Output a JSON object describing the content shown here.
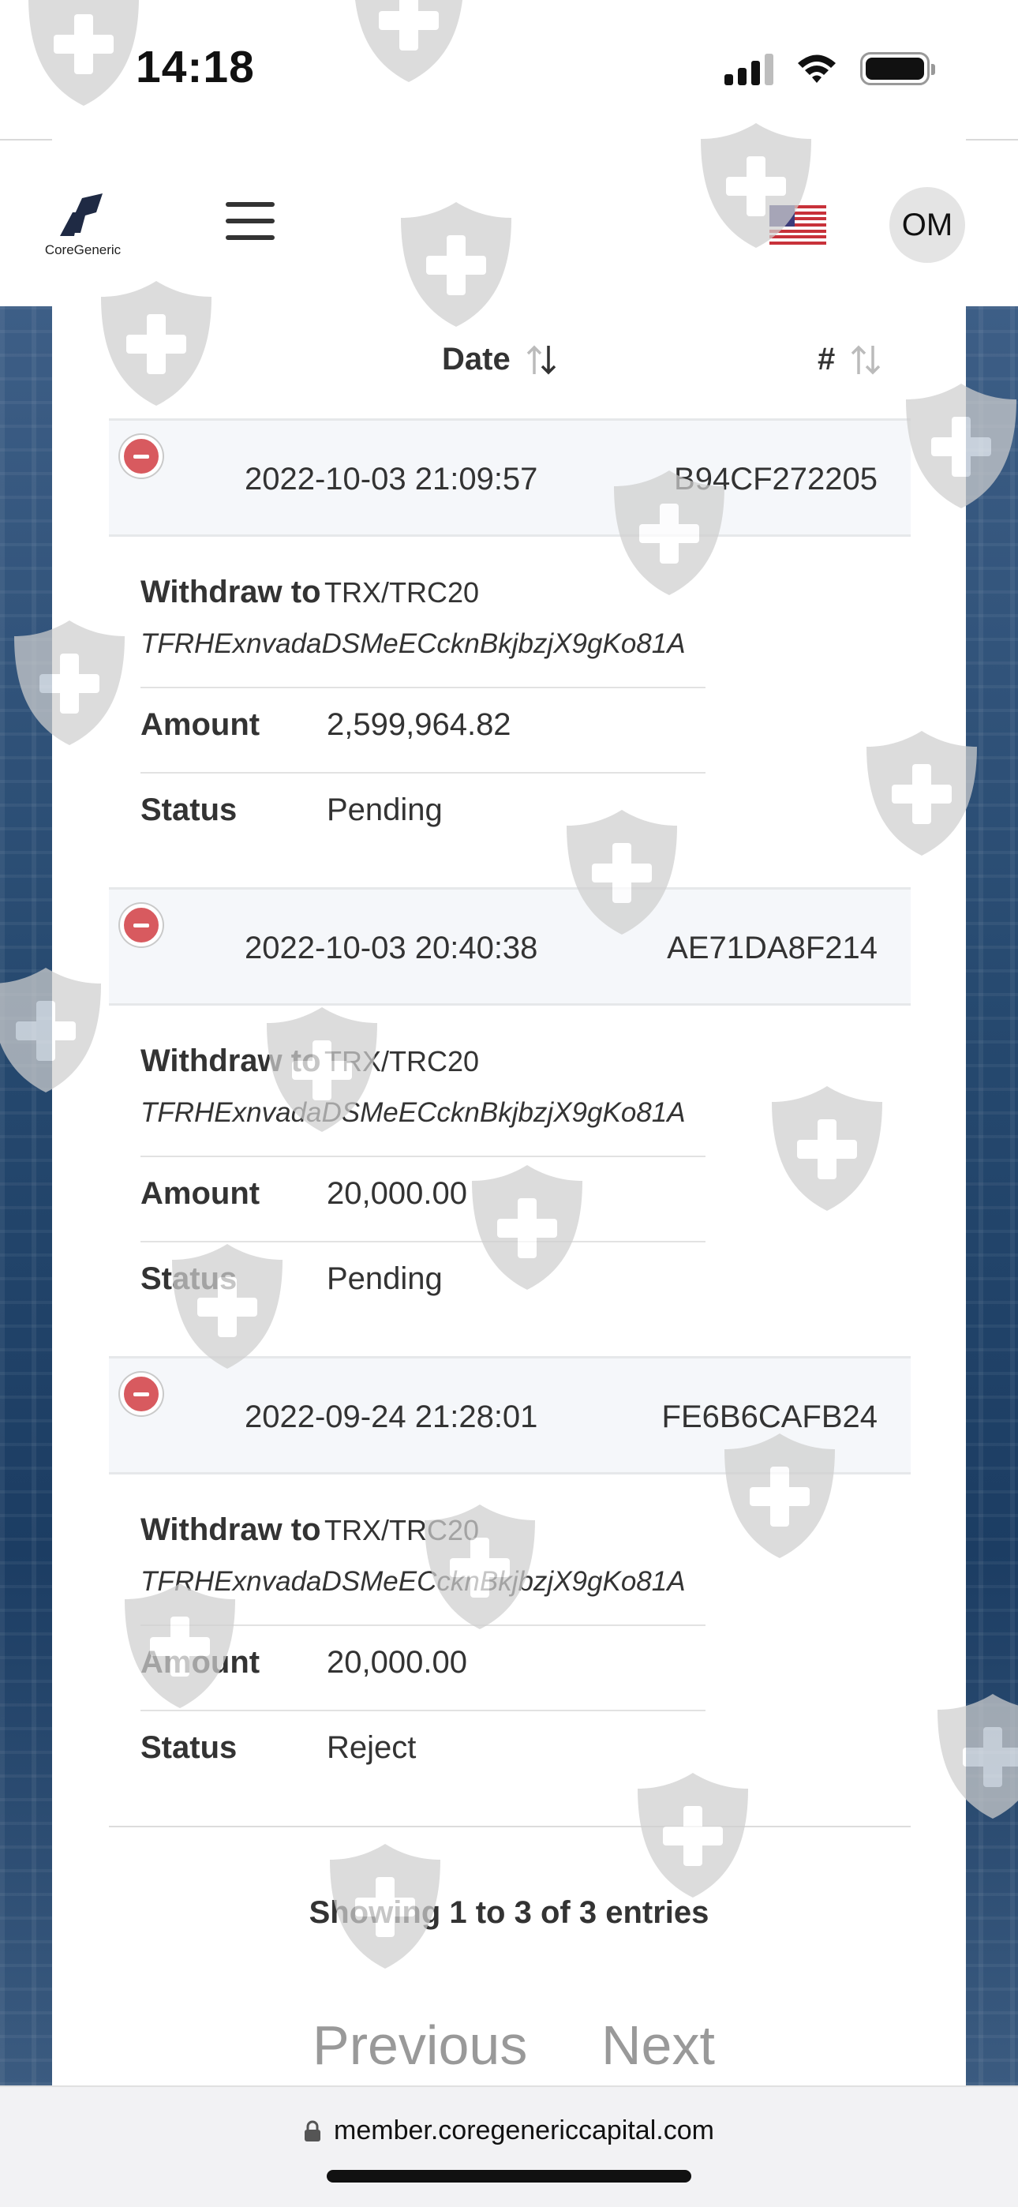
{
  "status_bar": {
    "time": "14:18"
  },
  "header": {
    "logo_text": "CoreGeneric",
    "avatar_initials": "OM",
    "flag": "us-flag-icon"
  },
  "table": {
    "columns": [
      {
        "label": "Date",
        "icon": "sort-icon"
      },
      {
        "label": "#",
        "icon": "sort-icon"
      }
    ],
    "entries": [
      {
        "date": "2022-10-03 21:09:57",
        "id": "B94CF272205",
        "withdraw_label": "Withdraw to",
        "network": "TRX/TRC20",
        "address": "TFRHExnvadaDSMeECcknBkjbzjX9gKo81A",
        "amount_label": "Amount",
        "amount": "2,599,964.82",
        "status_label": "Status",
        "status": "Pending"
      },
      {
        "date": "2022-10-03 20:40:38",
        "id": "AE71DA8F214",
        "withdraw_label": "Withdraw to",
        "network": "TRX/TRC20",
        "address": "TFRHExnvadaDSMeECcknBkjbzjX9gKo81A",
        "amount_label": "Amount",
        "amount": "20,000.00",
        "status_label": "Status",
        "status": "Pending"
      },
      {
        "date": "2022-09-24 21:28:01",
        "id": "FE6B6CAFB24",
        "withdraw_label": "Withdraw to",
        "network": "TRX/TRC20",
        "address": "TFRHExnvadaDSMeECcknBkjbzjX9gKo81A",
        "amount_label": "Amount",
        "amount": "20,000.00",
        "status_label": "Status",
        "status": "Reject"
      }
    ],
    "summary": "Showing 1 to 3 of 3 entries"
  },
  "pagination": {
    "previous": "Previous",
    "next": "Next"
  },
  "browser": {
    "url": "member.coregenericcapital.com"
  },
  "colors": {
    "remove_button": "#d85a5f",
    "row_header_bg": "#f5f7fa",
    "pager_text": "#999999"
  }
}
